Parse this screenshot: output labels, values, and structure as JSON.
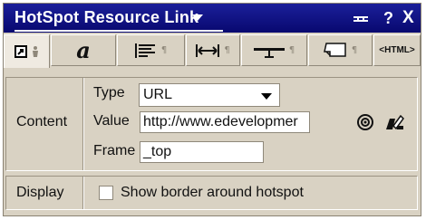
{
  "window": {
    "title": "HotSpot Resource Link",
    "help_label": "?",
    "close_label": "X"
  },
  "tabs": [
    {
      "name": "link-tab",
      "icon": "link-icon",
      "active": true
    },
    {
      "name": "text-style-tab",
      "icon": "text-style-icon",
      "glyph": "a"
    },
    {
      "name": "paragraph-tab",
      "icon": "paragraph-icon"
    },
    {
      "name": "spacing-tab",
      "icon": "spacing-icon"
    },
    {
      "name": "rule-tab",
      "icon": "rule-icon"
    },
    {
      "name": "hotspot-tab",
      "icon": "hotspot-icon"
    },
    {
      "name": "html-tab",
      "icon": "html-icon",
      "glyph": "HTML"
    }
  ],
  "content": {
    "section_label": "Content",
    "type_label": "Type",
    "type_value": "URL",
    "value_label": "Value",
    "value_text": "http://www.edevelopmer",
    "frame_label": "Frame",
    "frame_value": "_top",
    "browse_icon": "target-icon",
    "edit_icon": "link-edit-icon"
  },
  "display": {
    "section_label": "Display",
    "checkbox_label": "Show border around hotspot",
    "checked": false
  },
  "colors": {
    "titlebar": "#08086f",
    "panel": "#d9d2c3",
    "active_tab": "#efeae1"
  }
}
